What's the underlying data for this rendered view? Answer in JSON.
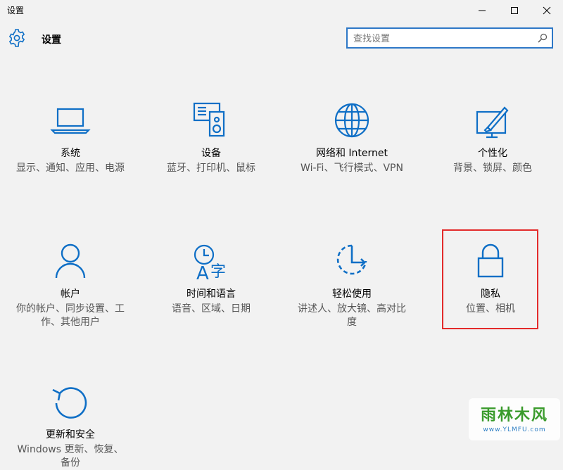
{
  "window": {
    "title": "设置"
  },
  "header": {
    "title": "设置"
  },
  "search": {
    "placeholder": "查找设置"
  },
  "tiles": [
    {
      "name": "系统",
      "desc": "显示、通知、应用、电源",
      "icon": "laptop-icon"
    },
    {
      "name": "设备",
      "desc": "蓝牙、打印机、鼠标",
      "icon": "devices-icon"
    },
    {
      "name": "网络和 Internet",
      "desc": "Wi-Fi、飞行模式、VPN",
      "icon": "globe-icon"
    },
    {
      "name": "个性化",
      "desc": "背景、锁屏、颜色",
      "icon": "personalization-icon"
    },
    {
      "name": "帐户",
      "desc": "你的帐户、同步设置、工作、其他用户",
      "icon": "person-icon"
    },
    {
      "name": "时间和语言",
      "desc": "语音、区域、日期",
      "icon": "time-language-icon"
    },
    {
      "name": "轻松使用",
      "desc": "讲述人、放大镜、高对比度",
      "icon": "ease-of-access-icon"
    },
    {
      "name": "隐私",
      "desc": "位置、相机",
      "icon": "lock-icon"
    },
    {
      "name": "更新和安全",
      "desc": "Windows 更新、恢复、备份",
      "icon": "refresh-icon"
    }
  ],
  "watermark": {
    "main": "雨林木风",
    "sub": "www.YLMFU.com"
  },
  "colors": {
    "accent": "#0f6fc6",
    "highlight": "#e32b2b",
    "background": "#f2f2f2"
  }
}
